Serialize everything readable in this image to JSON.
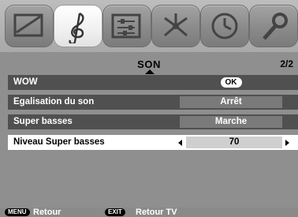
{
  "tabs": [
    {
      "name": "picture",
      "icon": "tv-picture-icon"
    },
    {
      "name": "sound",
      "icon": "treble-clef-icon"
    },
    {
      "name": "setup",
      "icon": "sliders-icon"
    },
    {
      "name": "features",
      "icon": "network-icon"
    },
    {
      "name": "timer",
      "icon": "clock-icon"
    },
    {
      "name": "settings",
      "icon": "wrench-icon"
    }
  ],
  "header": {
    "title": "SON",
    "page": "2/2"
  },
  "rows": [
    {
      "label": "WOW",
      "value": "OK"
    },
    {
      "label": "Egalisation du son",
      "value": "Arrêt"
    },
    {
      "label": "Super basses",
      "value": "Marche"
    },
    {
      "label": "Niveau Super basses",
      "value": "70"
    }
  ],
  "footer": {
    "menu_key": "MENU",
    "menu_label": "Retour",
    "exit_key": "EXIT",
    "exit_label": "Retour TV"
  }
}
